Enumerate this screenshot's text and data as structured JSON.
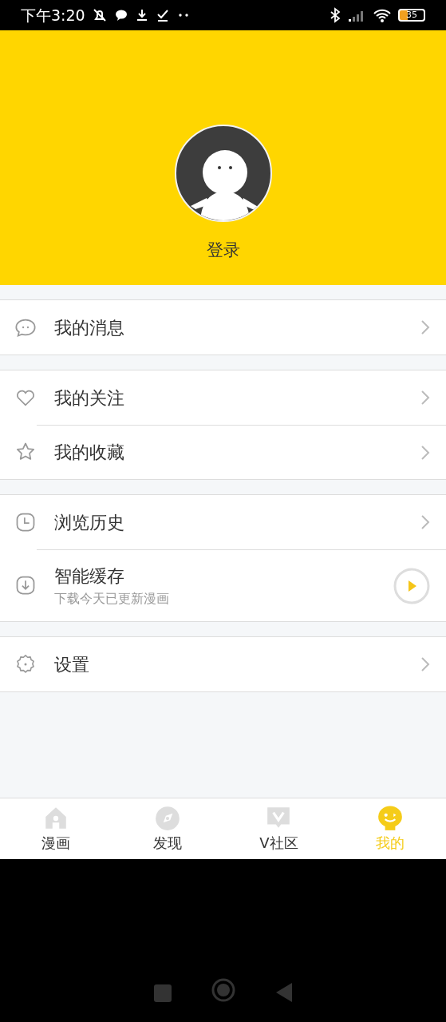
{
  "status_bar": {
    "time": "下午3:20",
    "battery": "35"
  },
  "profile": {
    "login": "登录"
  },
  "menu_groups": [
    {
      "items": [
        {
          "kind": "link",
          "label": "我的消息"
        }
      ]
    },
    {
      "items": [
        {
          "kind": "link",
          "label": "我的关注"
        },
        {
          "kind": "link",
          "label": "我的收藏"
        }
      ]
    },
    {
      "items": [
        {
          "kind": "link",
          "label": "浏览历史"
        },
        {
          "kind": "action",
          "label": "智能缓存",
          "subtitle": "下载今天已更新漫画"
        }
      ]
    },
    {
      "items": [
        {
          "kind": "link",
          "label": "设置"
        }
      ]
    }
  ],
  "tabs": [
    {
      "label": "漫画",
      "selected": false
    },
    {
      "label": "发现",
      "selected": false
    },
    {
      "label": "V社区",
      "selected": false
    },
    {
      "label": "我的",
      "selected": true
    }
  ]
}
